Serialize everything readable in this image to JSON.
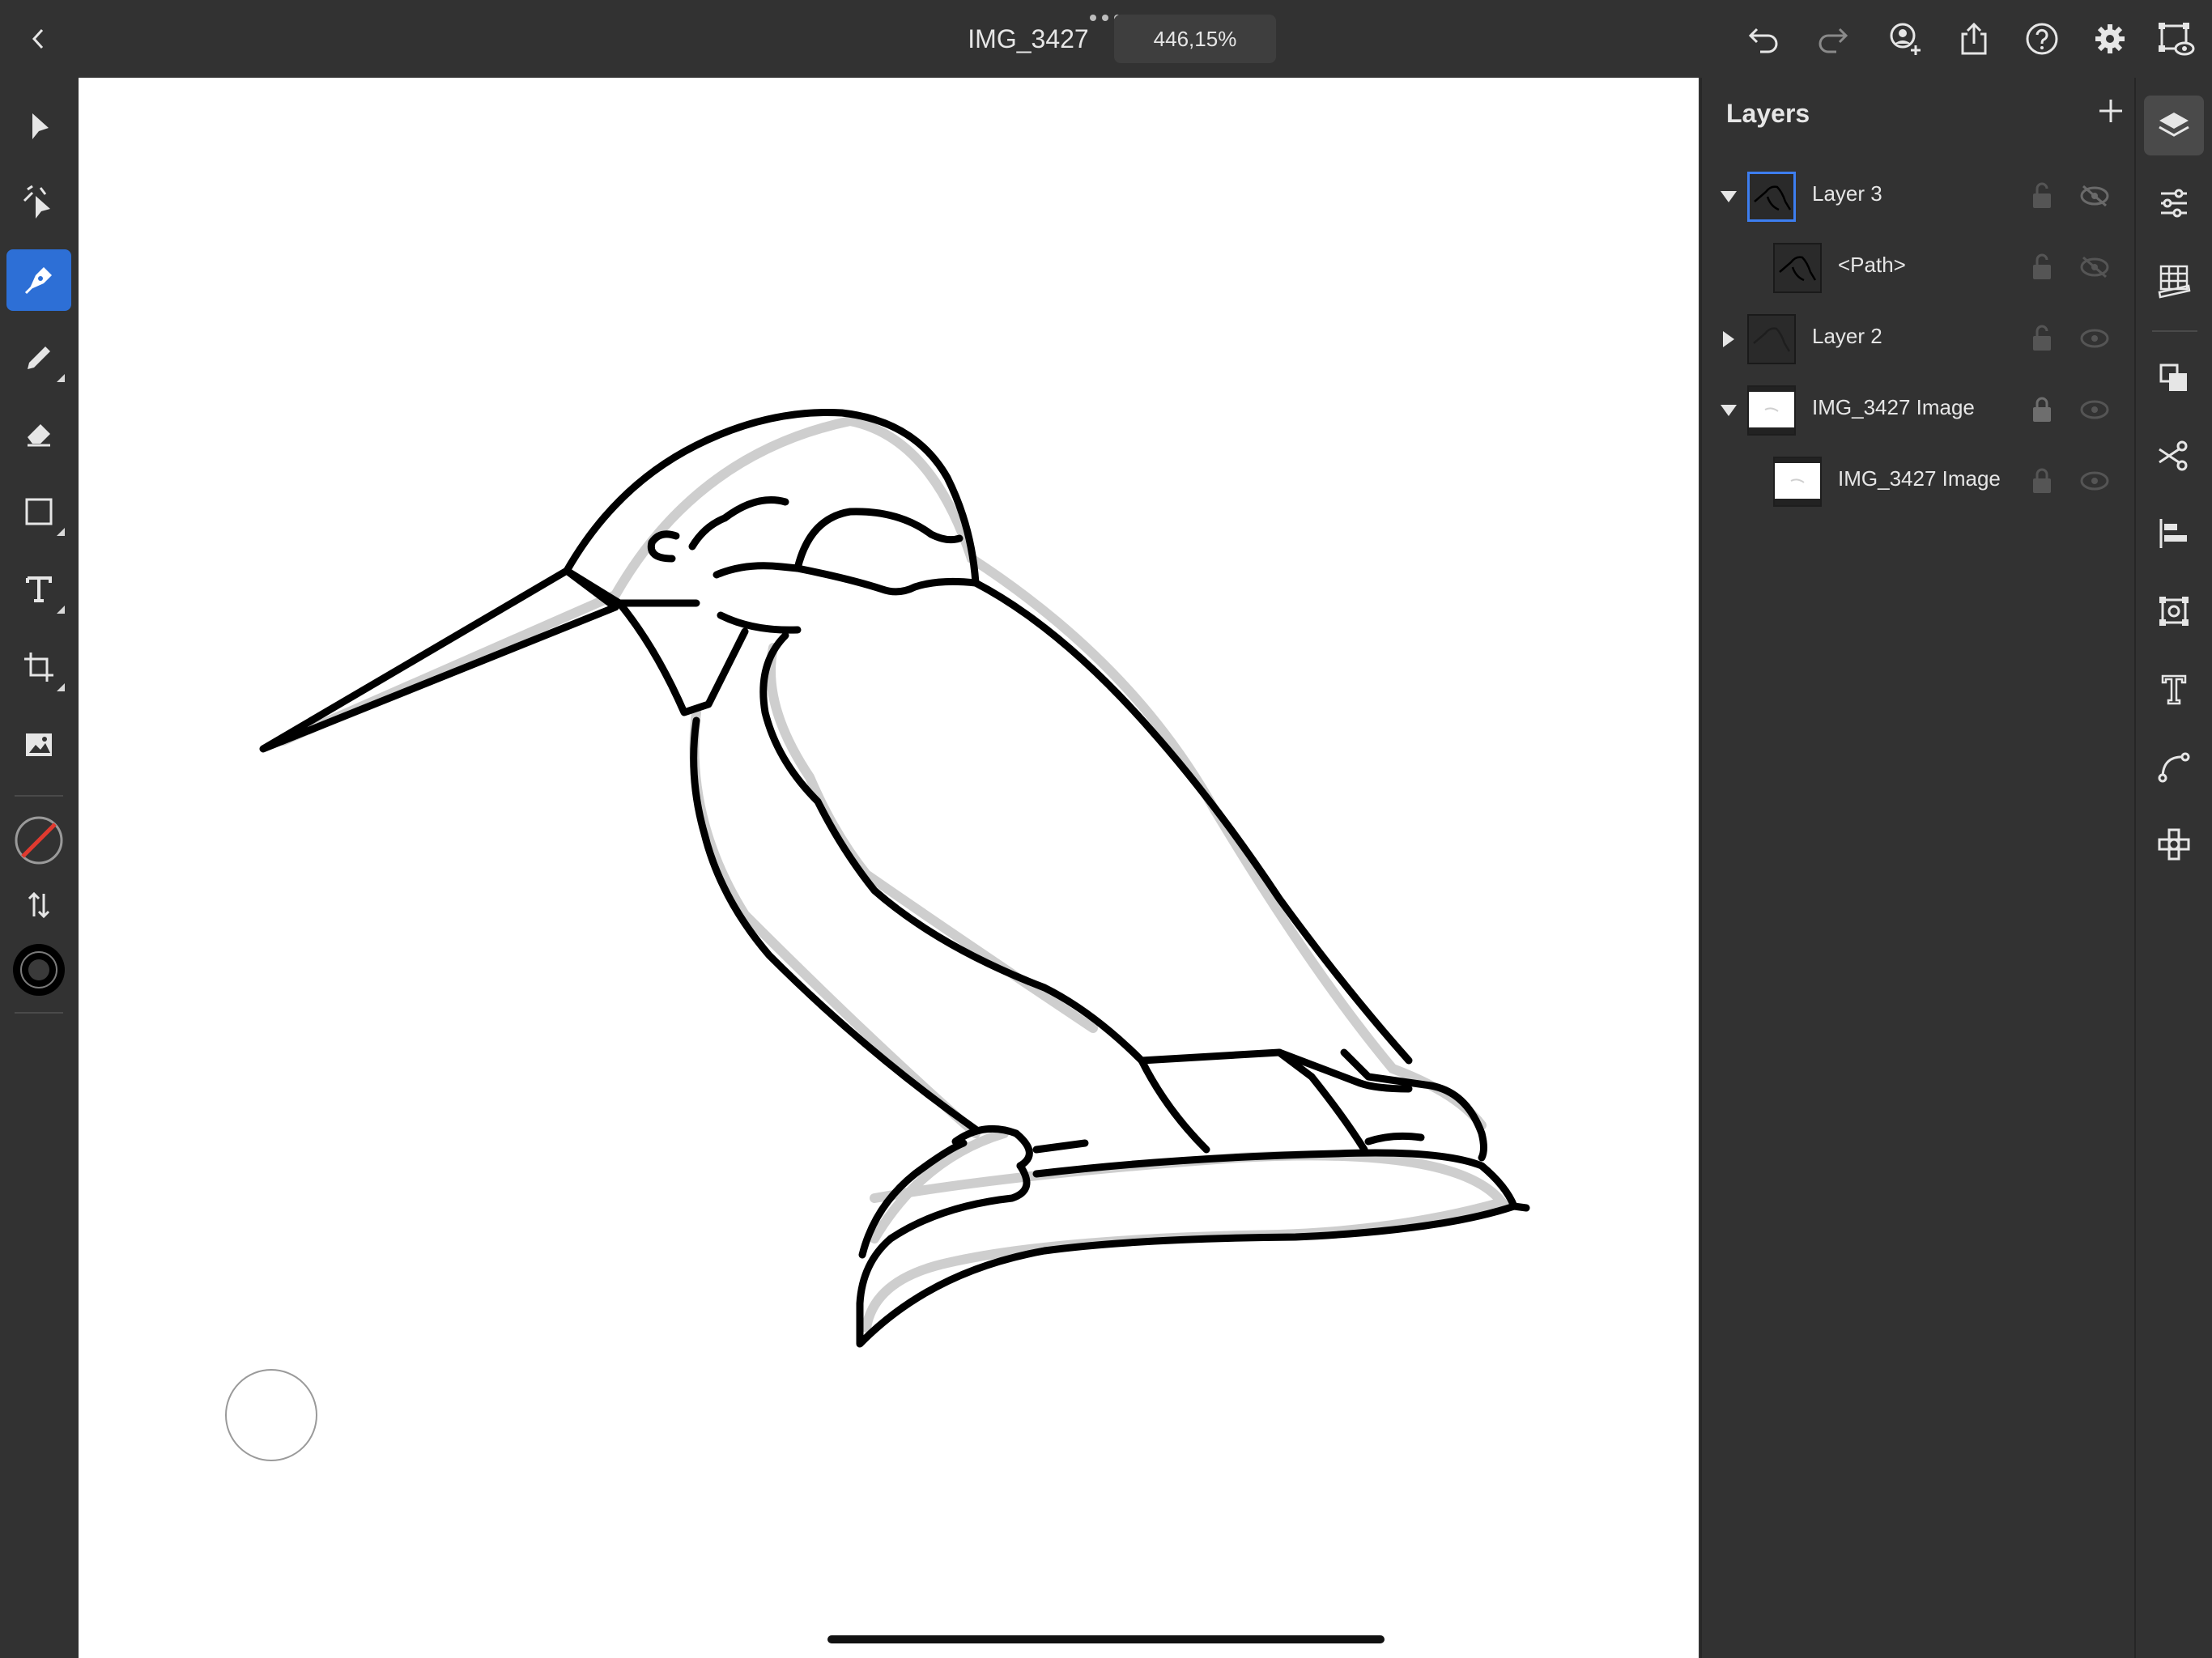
{
  "header": {
    "back_icon": "chevron-left-icon",
    "document_title": "IMG_3427",
    "zoom_level": "446,15%",
    "actions": [
      "undo-icon",
      "redo-icon",
      "invite-icon",
      "share-icon",
      "help-icon",
      "settings-icon",
      "preview-icon"
    ]
  },
  "left_toolbar": {
    "tools": [
      "selection-icon",
      "direct-selection-icon",
      "pen-icon",
      "pencil-icon",
      "eraser-icon",
      "rectangle-icon",
      "type-icon",
      "crop-icon",
      "image-icon"
    ],
    "active_tool": "pen-icon",
    "fill_color": "none",
    "stroke_color": "#000000"
  },
  "layers_panel": {
    "title": "Layers",
    "layers": [
      {
        "name": "Layer 3",
        "expanded": true,
        "selected": true,
        "locked": false,
        "visible": false
      },
      {
        "name": "<Path>",
        "child": true,
        "locked": false,
        "visible": false
      },
      {
        "name": "Layer 2",
        "expanded": false,
        "locked": false,
        "visible": true
      },
      {
        "name": "IMG_3427 Image",
        "expanded": true,
        "locked": true,
        "visible": true
      },
      {
        "name": "IMG_3427 Image",
        "child": true,
        "locked": true,
        "visible": true
      }
    ]
  },
  "right_rail": {
    "items": [
      "layers-icon",
      "properties-icon",
      "grid-icon",
      "arrange-icon",
      "path-operations-icon",
      "align-icon",
      "transform-icon",
      "type-panel-icon",
      "path-icon",
      "repeat-icon"
    ],
    "active": "layers-icon"
  },
  "colors": {
    "accent": "#2d6fd6",
    "panel_bg": "#323232",
    "canvas_bg": "#ffffff"
  }
}
